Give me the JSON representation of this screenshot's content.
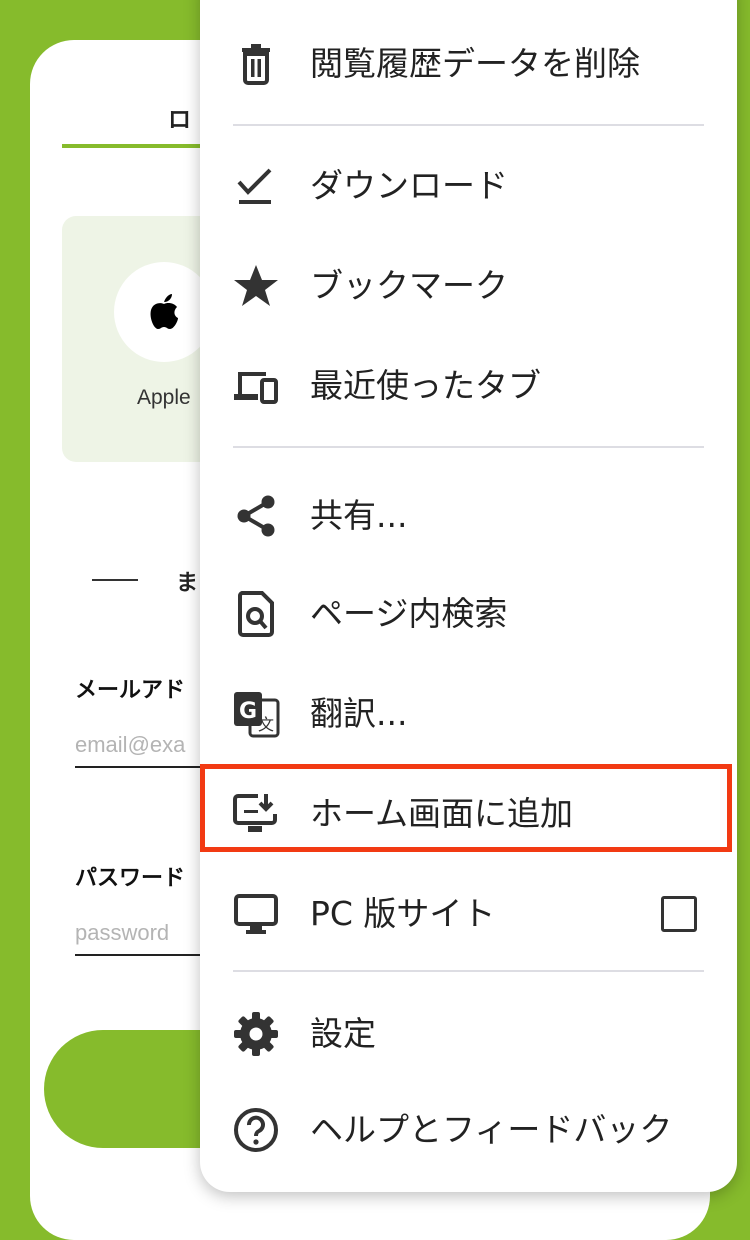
{
  "background_card": {
    "tab_label": "ロ",
    "social_label": "Apple",
    "divider_text": "ま",
    "email_label": "メールアド",
    "email_placeholder": "email@exa",
    "password_label": "パスワード",
    "password_placeholder": "password"
  },
  "menu": {
    "items": [
      {
        "id": "clear-history",
        "label": "閲覧履歴データを削除",
        "icon": "trash-icon"
      },
      {
        "id": "downloads",
        "label": "ダウンロード",
        "icon": "download-check-icon"
      },
      {
        "id": "bookmarks",
        "label": "ブックマーク",
        "icon": "star-icon"
      },
      {
        "id": "recent-tabs",
        "label": "最近使ったタブ",
        "icon": "devices-icon"
      },
      {
        "id": "share",
        "label": "共有...",
        "icon": "share-icon"
      },
      {
        "id": "find-in-page",
        "label": "ページ内検索",
        "icon": "find-in-page-icon"
      },
      {
        "id": "translate",
        "label": "翻訳...",
        "icon": "translate-icon"
      },
      {
        "id": "add-to-home",
        "label": "ホーム画面に追加",
        "icon": "add-to-home-screen-icon"
      },
      {
        "id": "desktop-site",
        "label": "PC 版サイト",
        "icon": "monitor-icon",
        "checkbox": false
      },
      {
        "id": "settings",
        "label": "設定",
        "icon": "gear-icon"
      },
      {
        "id": "help",
        "label": "ヘルプとフィードバック",
        "icon": "help-icon"
      }
    ]
  },
  "colors": {
    "brand_green": "#86bb2c",
    "highlight_red": "#f23a13",
    "icon_gray": "#333333"
  }
}
